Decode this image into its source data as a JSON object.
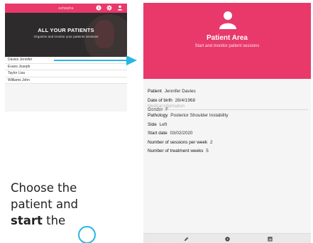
{
  "left_screen": {
    "brand": "ezhepha",
    "icons": [
      "info-icon",
      "gear-icon",
      "user-icon"
    ],
    "hero_title": "ALL YOUR PATIENTS",
    "hero_subtitle": "Organize and monitor your patients sessions",
    "patients": [
      "Davies Jennifer",
      "Evans Joseph",
      "Taylor Lisa",
      "Williams John"
    ],
    "selected_patient": "Davies Jennifer"
  },
  "right_screen": {
    "header_icon": "patient-icon",
    "title": "Patient Area",
    "subtitle": "Start and monitor patient sessions",
    "patient": [
      {
        "label": "Patient",
        "value": "Jennifer Davies"
      },
      {
        "label": "Date of birth",
        "value": "28/4/1968"
      },
      {
        "label": "Gender",
        "value": "F"
      }
    ],
    "medical_title": "Medical information",
    "medical": [
      {
        "label": "Pathology",
        "value": "Posterior Shoulder Instability"
      },
      {
        "label": "Side",
        "value": "Left"
      },
      {
        "label": "Start date",
        "value": "03/02/2020"
      },
      {
        "label": "Number of sessions per week",
        "value": "2"
      },
      {
        "label": "Number of treatment weeks",
        "value": "5"
      }
    ],
    "bottom_icons": [
      "pencil-icon",
      "play-icon",
      "chart-icon"
    ]
  },
  "caption": {
    "line1": "Choose the",
    "line2": "patient and",
    "line3_strong": "start",
    "line3_rest": " the"
  },
  "colors": {
    "accent": "#e8396a",
    "highlight": "#29b6e3",
    "hero_dark": "#2e2b2d"
  }
}
